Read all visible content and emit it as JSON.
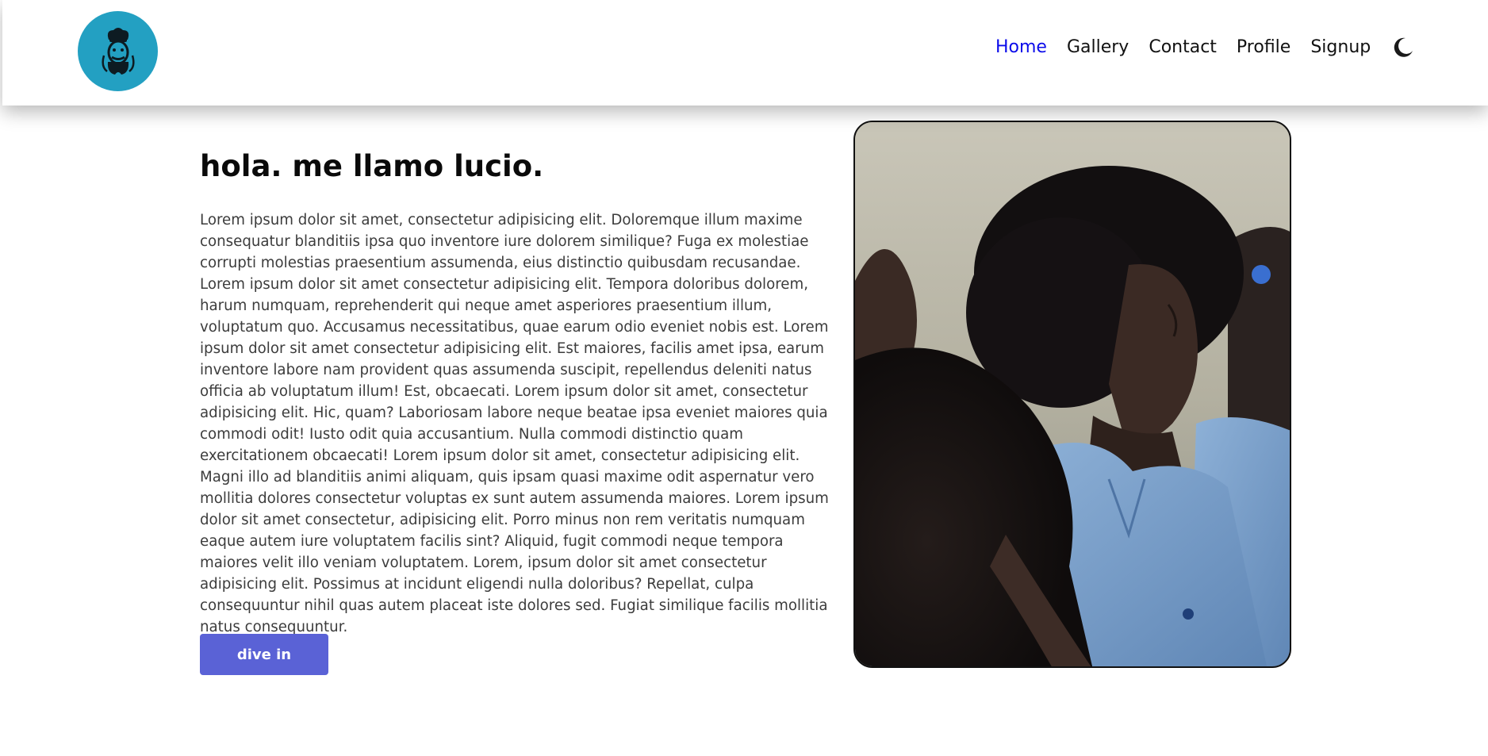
{
  "nav": {
    "links": [
      {
        "label": "Home",
        "active": true
      },
      {
        "label": "Gallery",
        "active": false
      },
      {
        "label": "Contact",
        "active": false
      },
      {
        "label": "Profile",
        "active": false
      },
      {
        "label": "Signup",
        "active": false
      }
    ],
    "theme_icon": "moon-icon",
    "logo_icon": "chef-logo-icon"
  },
  "hero": {
    "title": "hola. me llamo lucio.",
    "body": "Lorem ipsum dolor sit amet, consectetur adipisicing elit. Doloremque illum maxime consequatur blanditiis ipsa quo inventore iure dolorem similique? Fuga ex molestiae corrupti molestias praesentium assumenda, eius distinctio quibusdam recusandae. Lorem ipsum dolor sit amet consectetur adipisicing elit. Tempora doloribus dolorem, harum numquam, reprehenderit qui neque amet asperiores praesentium illum, voluptatum quo. Accusamus necessitatibus, quae earum odio eveniet nobis est. Lorem ipsum dolor sit amet consectetur adipisicing elit. Est maiores, facilis amet ipsa, earum inventore labore nam provident quas assumenda suscipit, repellendus deleniti natus officia ab voluptatum illum! Est, obcaecati. Lorem ipsum dolor sit amet, consectetur adipisicing elit. Hic, quam? Laboriosam labore neque beatae ipsa eveniet maiores quia commodi odit! Iusto odit quia accusantium. Nulla commodi distinctio quam exercitationem obcaecati! Lorem ipsum dolor sit amet, consectetur adipisicing elit. Magni illo ad blanditiis animi aliquam, quis ipsam quasi maxime odit aspernatur vero mollitia dolores consectetur voluptas ex sunt autem assumenda maiores. Lorem ipsum dolor sit amet consectetur, adipisicing elit. Porro minus non rem veritatis numquam eaque autem iure voluptatem facilis sint? Aliquid, fugit commodi neque tempora maiores velit illo veniam voluptatem. Lorem, ipsum dolor sit amet consectetur adipisicing elit. Possimus at incidunt eligendi nulla doloribus? Repellat, culpa consequuntur nihil quas autem placeat iste dolores sed. Fugiat similique facilis mollitia natus consequuntur.",
    "cta_label": "dive in"
  },
  "colors": {
    "logo_bg": "#23a0c2",
    "nav_active": "#0b0bea",
    "cta_bg": "#5a62d6"
  }
}
